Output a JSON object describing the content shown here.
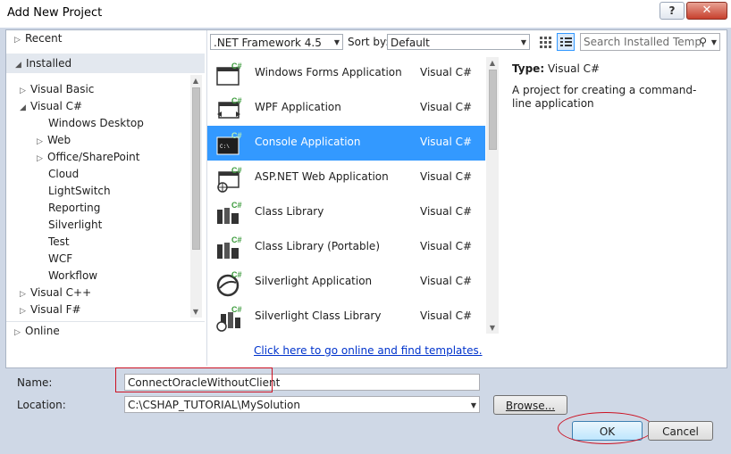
{
  "window": {
    "title": "Add New Project",
    "help_label": "?",
    "close_label": "✕"
  },
  "tree": {
    "recent": "Recent",
    "installed": "Installed",
    "items": [
      {
        "label": "Visual Basic"
      },
      {
        "label": "Visual C#"
      },
      {
        "label": "Windows Desktop"
      },
      {
        "label": "Web"
      },
      {
        "label": "Office/SharePoint"
      },
      {
        "label": "Cloud"
      },
      {
        "label": "LightSwitch"
      },
      {
        "label": "Reporting"
      },
      {
        "label": "Silverlight"
      },
      {
        "label": "Test"
      },
      {
        "label": "WCF"
      },
      {
        "label": "Workflow"
      },
      {
        "label": "Visual C++"
      },
      {
        "label": "Visual F#"
      }
    ],
    "online": "Online"
  },
  "toolbar": {
    "framework": ".NET Framework 4.5",
    "sort_label": "Sort by:",
    "sort_value": "Default",
    "search_placeholder": "Search Installed Temp"
  },
  "templates": [
    {
      "name": "Windows Forms Application",
      "lang": "Visual C#",
      "badge": "C#"
    },
    {
      "name": "WPF Application",
      "lang": "Visual C#",
      "badge": "C#"
    },
    {
      "name": "Console Application",
      "lang": "Visual C#",
      "badge": "C#",
      "icon_text": "C:\\"
    },
    {
      "name": "ASP.NET Web Application",
      "lang": "Visual C#",
      "badge": "C#"
    },
    {
      "name": "Class Library",
      "lang": "Visual C#",
      "badge": "C#"
    },
    {
      "name": "Class Library (Portable)",
      "lang": "Visual C#",
      "badge": "C#"
    },
    {
      "name": "Silverlight Application",
      "lang": "Visual C#",
      "badge": "C#"
    },
    {
      "name": "Silverlight Class Library",
      "lang": "Visual C#",
      "badge": "C#"
    }
  ],
  "online_link": "Click here to go online and find templates.",
  "details": {
    "type_label": "Type:",
    "type_value": "Visual C#",
    "description": "A project for creating a command-line application"
  },
  "form": {
    "name_label": "Name:",
    "name_value": "ConnectOracleWithoutClient",
    "location_label": "Location:",
    "location_value": "C:\\CSHAP_TUTORIAL\\MySolution",
    "browse_label": "Browse...",
    "ok_label": "OK",
    "cancel_label": "Cancel"
  },
  "colors": {
    "selection": "#3399ff",
    "highlight_ring": "#cc1122"
  }
}
